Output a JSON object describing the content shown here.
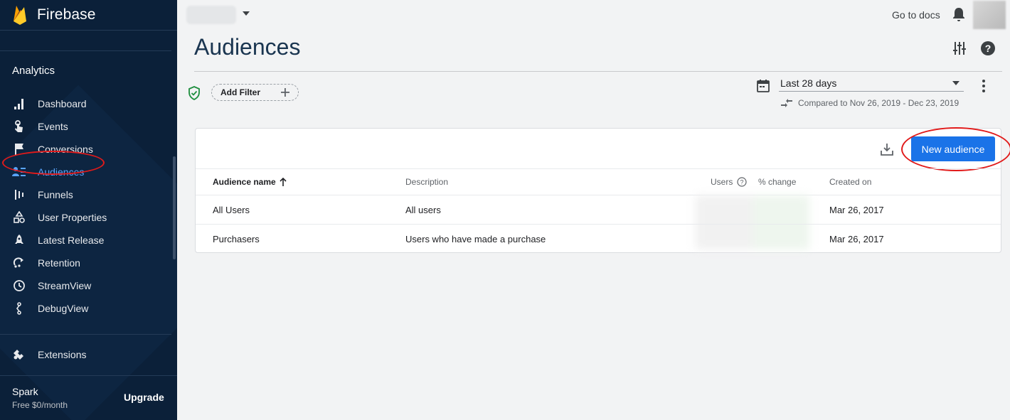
{
  "app": {
    "name": "Firebase"
  },
  "sidebar": {
    "section_title": "Analytics",
    "items": [
      {
        "label": "Dashboard",
        "icon": "bar-chart-icon"
      },
      {
        "label": "Events",
        "icon": "touch-icon"
      },
      {
        "label": "Conversions",
        "icon": "flag-icon"
      },
      {
        "label": "Audiences",
        "icon": "audience-icon",
        "active": true
      },
      {
        "label": "Funnels",
        "icon": "funnel-icon"
      },
      {
        "label": "User Properties",
        "icon": "shapes-icon"
      },
      {
        "label": "Latest Release",
        "icon": "rocket-icon"
      },
      {
        "label": "Retention",
        "icon": "retention-icon"
      },
      {
        "label": "StreamView",
        "icon": "clock-icon"
      },
      {
        "label": "DebugView",
        "icon": "debug-icon"
      }
    ],
    "extensions_label": "Extensions",
    "plan_name": "Spark",
    "plan_price": "Free $0/month",
    "upgrade_label": "Upgrade"
  },
  "topbar": {
    "docs_label": "Go to docs"
  },
  "page": {
    "title": "Audiences",
    "add_filter_label": "Add Filter",
    "date_range": "Last 28 days",
    "compare_text": "Compared to Nov 26, 2019 - Dec 23, 2019"
  },
  "table": {
    "new_audience_label": "New audience",
    "headers": {
      "name": "Audience name",
      "description": "Description",
      "users": "Users",
      "change": "% change",
      "created": "Created on"
    },
    "rows": [
      {
        "name": "All Users",
        "description": "All users",
        "created": "Mar 26, 2017"
      },
      {
        "name": "Purchasers",
        "description": "Users who have made a purchase",
        "created": "Mar 26, 2017"
      }
    ]
  },
  "colors": {
    "sidebar_bg": "#0b2039",
    "accent": "#1a73e8",
    "active_nav": "#5aa5ff",
    "annotation": "#e11a1a"
  }
}
